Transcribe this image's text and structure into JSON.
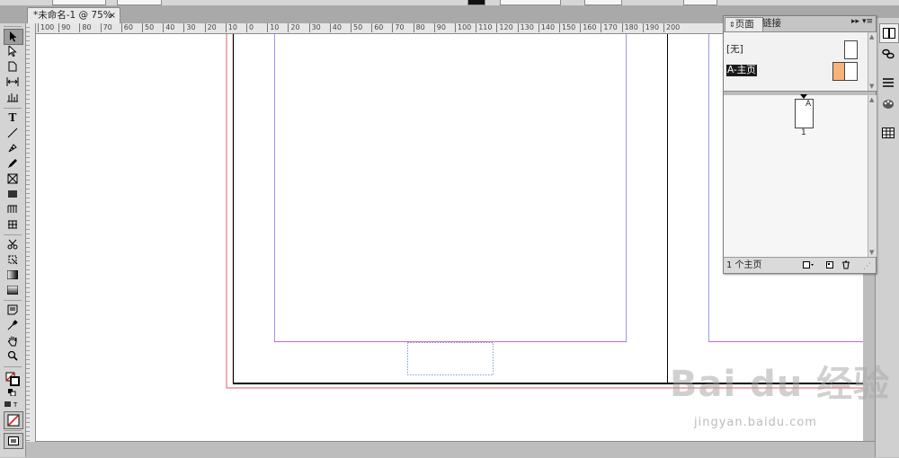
{
  "document_tab": {
    "title": "*未命名-1 @ 75%",
    "close": "×"
  },
  "ruler": {
    "ticks": [
      "100",
      "90",
      "80",
      "70",
      "60",
      "50",
      "40",
      "30",
      "20",
      "10",
      "0",
      "10",
      "20",
      "30",
      "40",
      "50",
      "60",
      "70",
      "80",
      "90",
      "100",
      "110",
      "120",
      "130",
      "140",
      "150",
      "160",
      "170",
      "180",
      "190",
      "200"
    ]
  },
  "pages_panel": {
    "tabs": {
      "pages": "页面",
      "links": "链接"
    },
    "masters": [
      {
        "name": "[无]"
      },
      {
        "name": "A-主页",
        "selected": true
      }
    ],
    "page_letter": "A",
    "page_number": "1",
    "footer_text": "1 个主页"
  },
  "watermark": {
    "logo": "Bai du 经验",
    "url": "jingyan.baidu.com"
  },
  "colors": {
    "margin_guide": "#cc66cc",
    "column_guide": "#9999ee",
    "bleed_guide": "#e05a6a",
    "master_swatch": "#f7b37a"
  }
}
